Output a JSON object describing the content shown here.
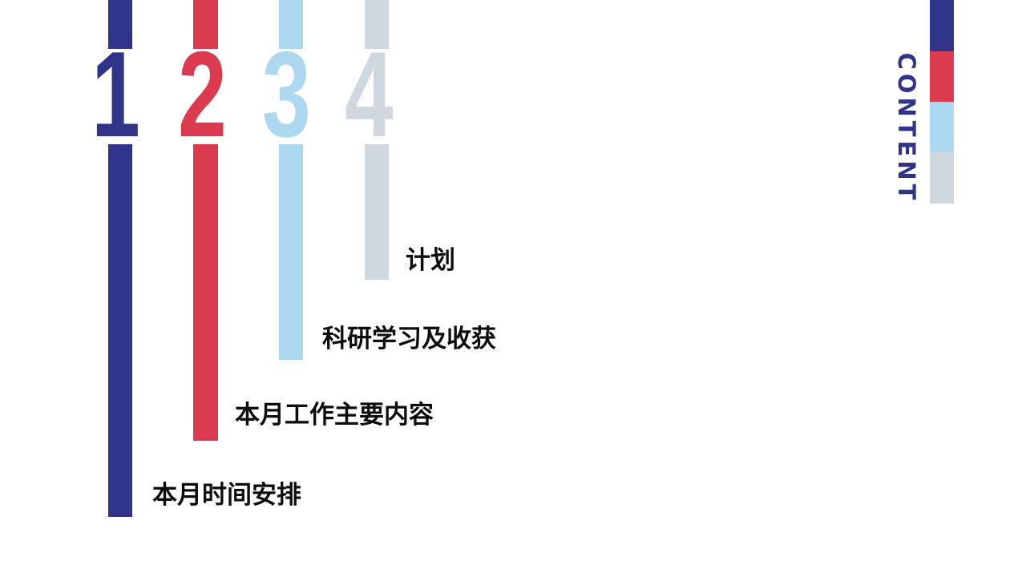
{
  "colors": {
    "navy": "#303489",
    "red": "#db3b4e",
    "light_blue": "#acd9f0",
    "gray": "#cfd8df"
  },
  "header": {
    "content_label": "CONTENT"
  },
  "items": [
    {
      "number": "1",
      "label": "本月时间安排"
    },
    {
      "number": "2",
      "label": "本月工作主要内容"
    },
    {
      "number": "3",
      "label": "科研学习及收获"
    },
    {
      "number": "4",
      "label": "计划"
    }
  ]
}
